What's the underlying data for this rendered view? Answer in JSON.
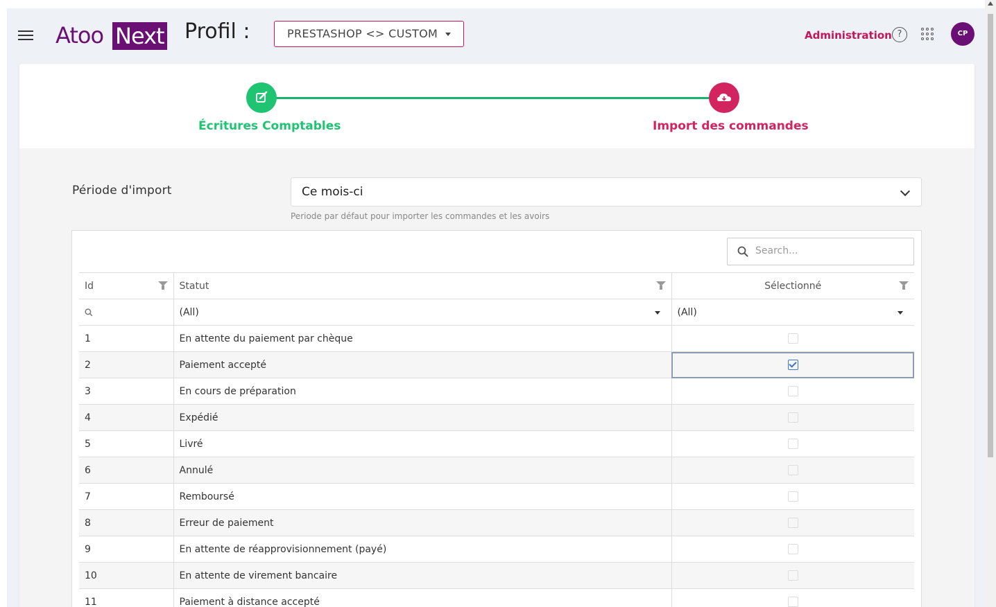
{
  "header": {
    "logo_part1": "Atoo",
    "logo_part2": "Next",
    "profile_label": "Profil :",
    "profile_select": "PRESTASHOP <> CUSTOM",
    "admin_link": "Administration",
    "help_glyph": "?",
    "avatar_initials": "CP",
    "brand_color": "#6a0f74",
    "accent_color": "#c2185b"
  },
  "stepper": {
    "steps": [
      {
        "label": "Écritures Comptables",
        "icon": "edit-icon",
        "color": "#1ec472"
      },
      {
        "label": "Import des commandes",
        "icon": "cloud-download-icon",
        "color": "#d2245e"
      }
    ]
  },
  "period": {
    "label": "Période d'import",
    "value": "Ce mois-ci",
    "help": "Periode par défaut pour importer les commandes et les avoirs"
  },
  "grid": {
    "search_placeholder": "Search...",
    "columns": [
      "Id",
      "Statut",
      "Sélectionné"
    ],
    "filter_row": {
      "statut": "(All)",
      "selectionne": "(All)"
    },
    "rows": [
      {
        "id": "1",
        "statut": "En attente du paiement par chèque",
        "selected": false
      },
      {
        "id": "2",
        "statut": "Paiement accepté",
        "selected": true
      },
      {
        "id": "3",
        "statut": "En cours de préparation",
        "selected": false
      },
      {
        "id": "4",
        "statut": "Expédié",
        "selected": false
      },
      {
        "id": "5",
        "statut": "Livré",
        "selected": false
      },
      {
        "id": "6",
        "statut": "Annulé",
        "selected": false
      },
      {
        "id": "7",
        "statut": "Remboursé",
        "selected": false
      },
      {
        "id": "8",
        "statut": "Erreur de paiement",
        "selected": false
      },
      {
        "id": "9",
        "statut": "En attente de réapprovisionnement (payé)",
        "selected": false
      },
      {
        "id": "10",
        "statut": "En attente de virement bancaire",
        "selected": false
      },
      {
        "id": "11",
        "statut": "Paiement à distance accepté",
        "selected": false
      }
    ]
  }
}
